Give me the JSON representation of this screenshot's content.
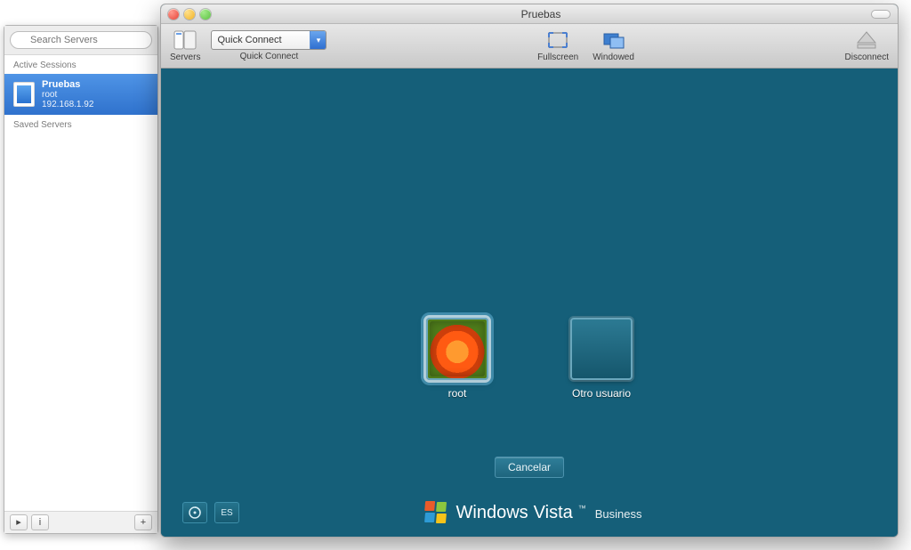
{
  "sidebar": {
    "search_placeholder": "Search Servers",
    "active_label": "Active Sessions",
    "saved_label": "Saved Servers",
    "session": {
      "name": "Pruebas",
      "user": "root",
      "ip": "192.168.1.92"
    },
    "footer": {
      "play_label": "▸",
      "info_label": "i",
      "add_label": "+"
    }
  },
  "window": {
    "title": "Pruebas",
    "toolbar": {
      "servers": "Servers",
      "quick_connect_label": "Quick Connect",
      "quick_connect_field": "Quick Connect",
      "fullscreen": "Fullscreen",
      "windowed": "Windowed",
      "disconnect": "Disconnect"
    }
  },
  "vista": {
    "users": {
      "root": "root",
      "other": "Otro usuario"
    },
    "cancel": "Cancelar",
    "lang": "ES",
    "brand": {
      "win": "Windows",
      "vista": "Vista",
      "tm": "™",
      "edition": "Business"
    }
  },
  "colors": {
    "teal": "#155f79",
    "selection": "#2f72cd"
  }
}
